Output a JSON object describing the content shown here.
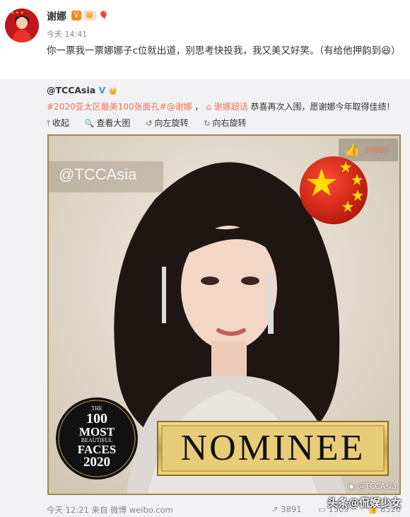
{
  "post": {
    "username": "谢娜",
    "verified_badge": "V",
    "time": "今天 14:41",
    "text": "你一票我一票娜娜子c位就出道，别思考快投我，我又美又好笑。（有给他押韵到😆）"
  },
  "repost": {
    "username": "@TCCAsia",
    "hashtag": "#2020亚太区最美100张面孔#",
    "mention": "@谢娜",
    "supertopic": "谢娜超话",
    "message": "恭喜再次入围，愿谢娜今年取得佳绩！",
    "tools": [
      "收起",
      "查看大图",
      "向左旋转",
      "向右旋转"
    ],
    "image": {
      "watermark": "@TCCAsia",
      "like_count": "30885",
      "badge_lines": [
        "THE",
        "100",
        "MOST",
        "BEAUTIFUL",
        "FACES",
        "2020"
      ],
      "nominee": "NOMINEE",
      "weibo_watermark": "@TCCAsia"
    },
    "footer": {
      "meta": "今天 12:21 来自 微博 weibo.com",
      "shares": "3891",
      "comments": "1509",
      "likes": "8526"
    }
  },
  "overlay": "头条@侃娱少女",
  "colors": {
    "accent": "#eb7350",
    "frame": "#a08a54",
    "flag_red": "#de2910",
    "flag_star": "#ffde00"
  }
}
